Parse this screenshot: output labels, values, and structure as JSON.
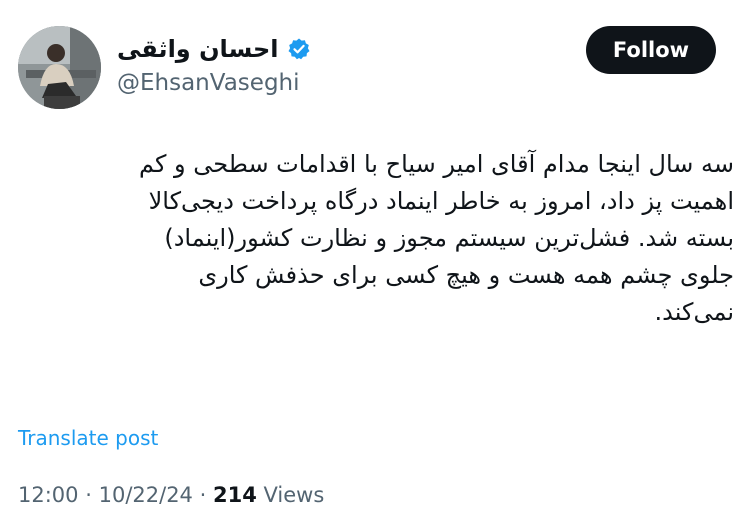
{
  "author": {
    "display_name": "احسان واثقی",
    "handle": "@EhsanVaseghi",
    "verified_icon": "verified-badge-icon"
  },
  "actions": {
    "follow_label": "Follow"
  },
  "post": {
    "lines": [
      "سه سال اینجا مدام آقای امیر سیاح با اقدامات سطحی و کم",
      "اهمیت پز داد، امروز به خاطر اینماد درگاه پرداخت دیجی‌کالا",
      "بسته شد. فشل‌ترین سیستم مجوز و نظارت کشور(اینماد)",
      "جلوی چشم همه هست و هیچ کسی برای حذفش کاری",
      "نمی‌کند."
    ],
    "translate_label": "Translate post"
  },
  "meta": {
    "time": "12:00",
    "separator": "·",
    "date": "10/22/24",
    "views_count": "214",
    "views_label": "Views"
  },
  "colors": {
    "accent": "#1d9bf0",
    "text": "#0f1419",
    "secondary": "#536471",
    "button_bg": "#0f1419"
  }
}
